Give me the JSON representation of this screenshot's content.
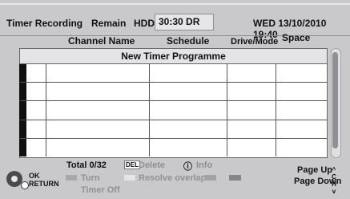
{
  "header": {
    "title": "Timer Recording",
    "remain_label": "Remain",
    "hdd_label": "HDD",
    "hdd_value": "30:30 DR",
    "datetime": "WED 13/10/2010 19:40"
  },
  "columns": {
    "channel": "Channel Name",
    "schedule": "Schedule",
    "drive_mode": "Drive/Mode",
    "space": "Space"
  },
  "table": {
    "banner": "New Timer Programme"
  },
  "footer": {
    "total": "Total 0/32",
    "del_key": "DEL",
    "delete_label": "Delete",
    "info_icon": "ⓘ",
    "info_label": "Info",
    "ok_label": "OK",
    "return_label": "RETURN",
    "turn_label": "Turn",
    "timer_off_label": "Timer Off",
    "resolve_label": "Resolve overlap",
    "page_up": "Page Up",
    "page_down": "Page Down",
    "ch_up": "^",
    "ch_label1": "C",
    "ch_label2": "H",
    "ch_down": "v"
  },
  "colors": {
    "background": "#c9c9cc",
    "table_bg": "#ffffff",
    "banner_bg": "#e3e3e8"
  }
}
